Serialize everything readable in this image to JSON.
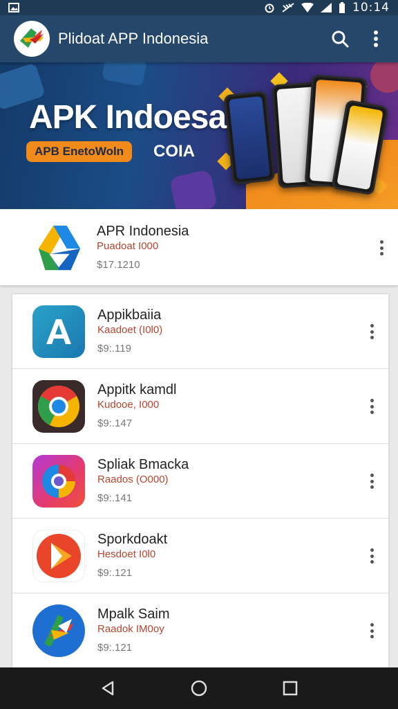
{
  "status_bar": {
    "time": "10:14"
  },
  "app_bar": {
    "title": "Plidoat APP Indonesia",
    "search_icon": "search-icon",
    "menu_icon": "more-vert-icon"
  },
  "banner": {
    "title": "APK Indoesa",
    "pill_text": "APB EnetoWoln",
    "pill_suffix": "COIA"
  },
  "featured": {
    "name": "APR Indonesia",
    "publisher": "Puadoat I000",
    "price": "$17.1210"
  },
  "apps": [
    {
      "name": "Appikbaiia",
      "publisher": "Kaadoet (I0l0)",
      "price": "$9:.119",
      "icon": "a-letter-icon"
    },
    {
      "name": "Appitk kamdl",
      "publisher": "Kudooe, I000",
      "price": "$9:.147",
      "icon": "chrome-style-icon"
    },
    {
      "name": "Spliak Bmacka",
      "publisher": "Raados (O000)",
      "price": "$9:.141",
      "icon": "swirl-icon"
    },
    {
      "name": "Sporkdoakt",
      "publisher": "Hesdoet I0l0",
      "price": "$9:.121",
      "icon": "play-icon"
    },
    {
      "name": "Mpalk Saim",
      "publisher": "Raadok IM0oy",
      "price": "$9:.121",
      "icon": "arrow-logo-icon"
    }
  ],
  "colors": {
    "appbar": "#24476a",
    "accent_orange": "#f08a1a",
    "publisher_red": "#b5452f"
  }
}
